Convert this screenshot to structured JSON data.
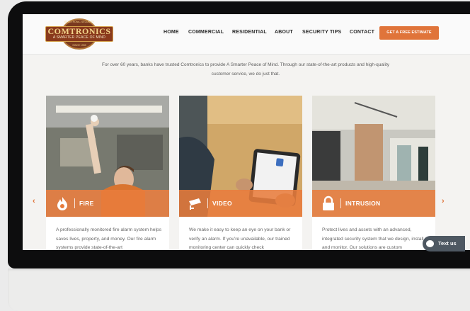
{
  "logo": {
    "name": "COMTRONICS",
    "tagline": "A SMARTER PEACE OF MIND",
    "arc_top": "ELECTRONIC SECURITY",
    "arc_bottom": "SINCE 1959"
  },
  "nav": {
    "items": [
      "HOME",
      "COMMERCIAL",
      "RESIDENTIAL",
      "ABOUT",
      "SECURITY TIPS",
      "CONTACT"
    ],
    "cta": "GET A FREE ESTIMATE"
  },
  "intro": "For over 60 years, banks have trusted Comtronics to provide A Smarter Peace of Mind. Through our state-of-the-art products and high-quality customer service, we do just that.",
  "cards": [
    {
      "label": "FIRE",
      "icon": "flame-icon",
      "text": "A professionally monitored fire alarm system helps saves lives, property, and money. Our fire alarm systems provide state-of-the-art"
    },
    {
      "label": "VIDEO",
      "icon": "security-camera-icon",
      "text": "We make it easy to keep an eye on your bank or verify an alarm. If you're unavailable, our trained monitoring center can quickly check"
    },
    {
      "label": "INTRUSION",
      "icon": "padlock-icon",
      "text": "Protect lives and assets with an advanced, integrated security system that we design, install, and monitor. Our solutions are custom"
    }
  ],
  "carousel": {
    "prev": "‹",
    "next": "›"
  },
  "chat": {
    "label": "Text us"
  },
  "colors": {
    "accent": "#e0743a",
    "logo_bg": "#8a3a1c",
    "chat_bg": "#4e5862"
  }
}
